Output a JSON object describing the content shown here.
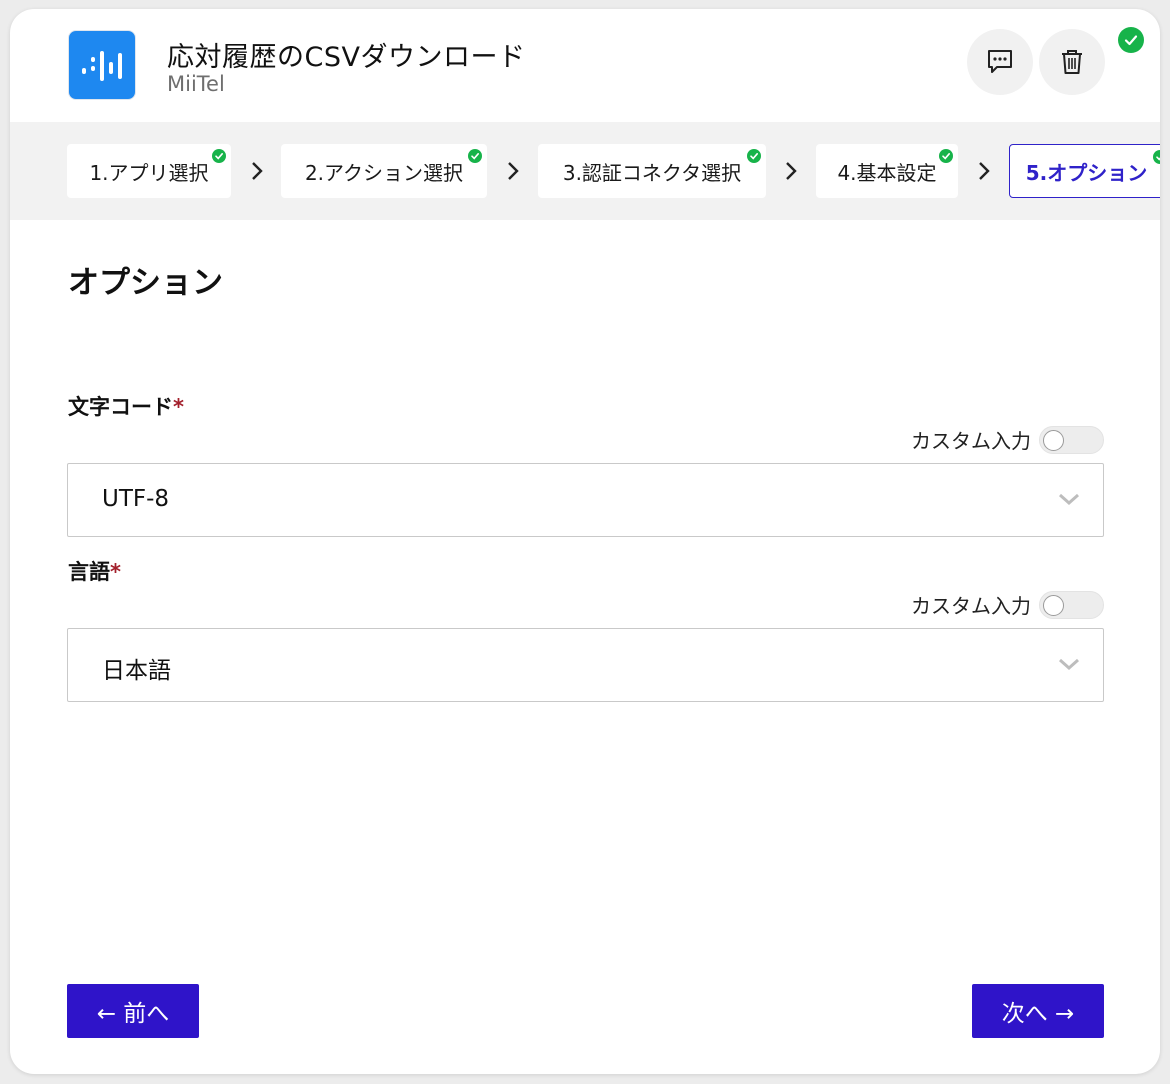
{
  "header": {
    "title": "応対履歴のCSVダウンロード",
    "app_name": "MiiTel",
    "icons": [
      "miitel-logo-icon",
      "comment-icon",
      "trash-icon",
      "check-circle-icon"
    ]
  },
  "steps": [
    {
      "label": "1.アプリ選択",
      "completed": true
    },
    {
      "label": "2.アクション選択",
      "completed": true
    },
    {
      "label": "3.認証コネクタ選択",
      "completed": true
    },
    {
      "label": "4.基本設定",
      "completed": true
    },
    {
      "label": "5.オプション",
      "completed": true,
      "active": true
    }
  ],
  "section": {
    "title": "オプション"
  },
  "fields": [
    {
      "label": "文字コード",
      "required_mark": "*",
      "custom_input_label": "カスタム入力",
      "custom_input_on": false,
      "selected_value": "UTF-8"
    },
    {
      "label": "言語",
      "required_mark": "*",
      "custom_input_label": "カスタム入力",
      "custom_input_on": false,
      "selected_value": "日本語"
    }
  ],
  "footer": {
    "prev_label": "← 前へ",
    "next_label": "次へ →"
  },
  "colors": {
    "primary": "#2f14c9",
    "success": "#17b34a",
    "required": "#a3202c",
    "app_icon_bg": "#1e88f0"
  }
}
